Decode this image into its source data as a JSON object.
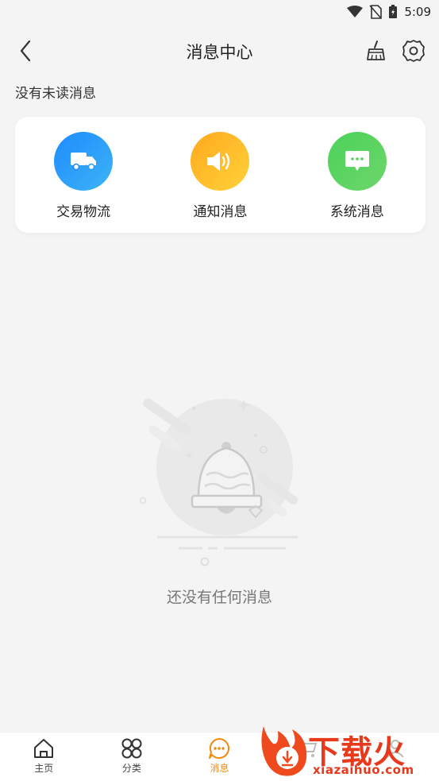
{
  "status_bar": {
    "time": "5:09"
  },
  "nav": {
    "title": "消息中心"
  },
  "unread_text": "没有未读消息",
  "categories": [
    {
      "label": "交易物流",
      "icon": "truck-icon",
      "color_from": "#1e8bff",
      "color_to": "#3db4f5"
    },
    {
      "label": "通知消息",
      "icon": "speaker-icon",
      "color_from": "#ffa81e",
      "color_to": "#ffd23a"
    },
    {
      "label": "系统消息",
      "icon": "chat-bubble-icon",
      "color_from": "#4cd25a",
      "color_to": "#6cd66a"
    }
  ],
  "empty": {
    "text": "还没有任何消息"
  },
  "tabs": [
    {
      "label": "主页",
      "icon": "home-icon"
    },
    {
      "label": "分类",
      "icon": "grid-icon"
    },
    {
      "label": "消息",
      "icon": "message-icon",
      "active": true
    },
    {
      "label": "",
      "icon": "cart-icon"
    },
    {
      "label": "",
      "icon": "profile-icon"
    }
  ],
  "watermark": {
    "text": "下载火",
    "url": "xiazaihuo.com"
  },
  "colors": {
    "accent": "#f08a0c",
    "watermark": "#e8391c"
  }
}
